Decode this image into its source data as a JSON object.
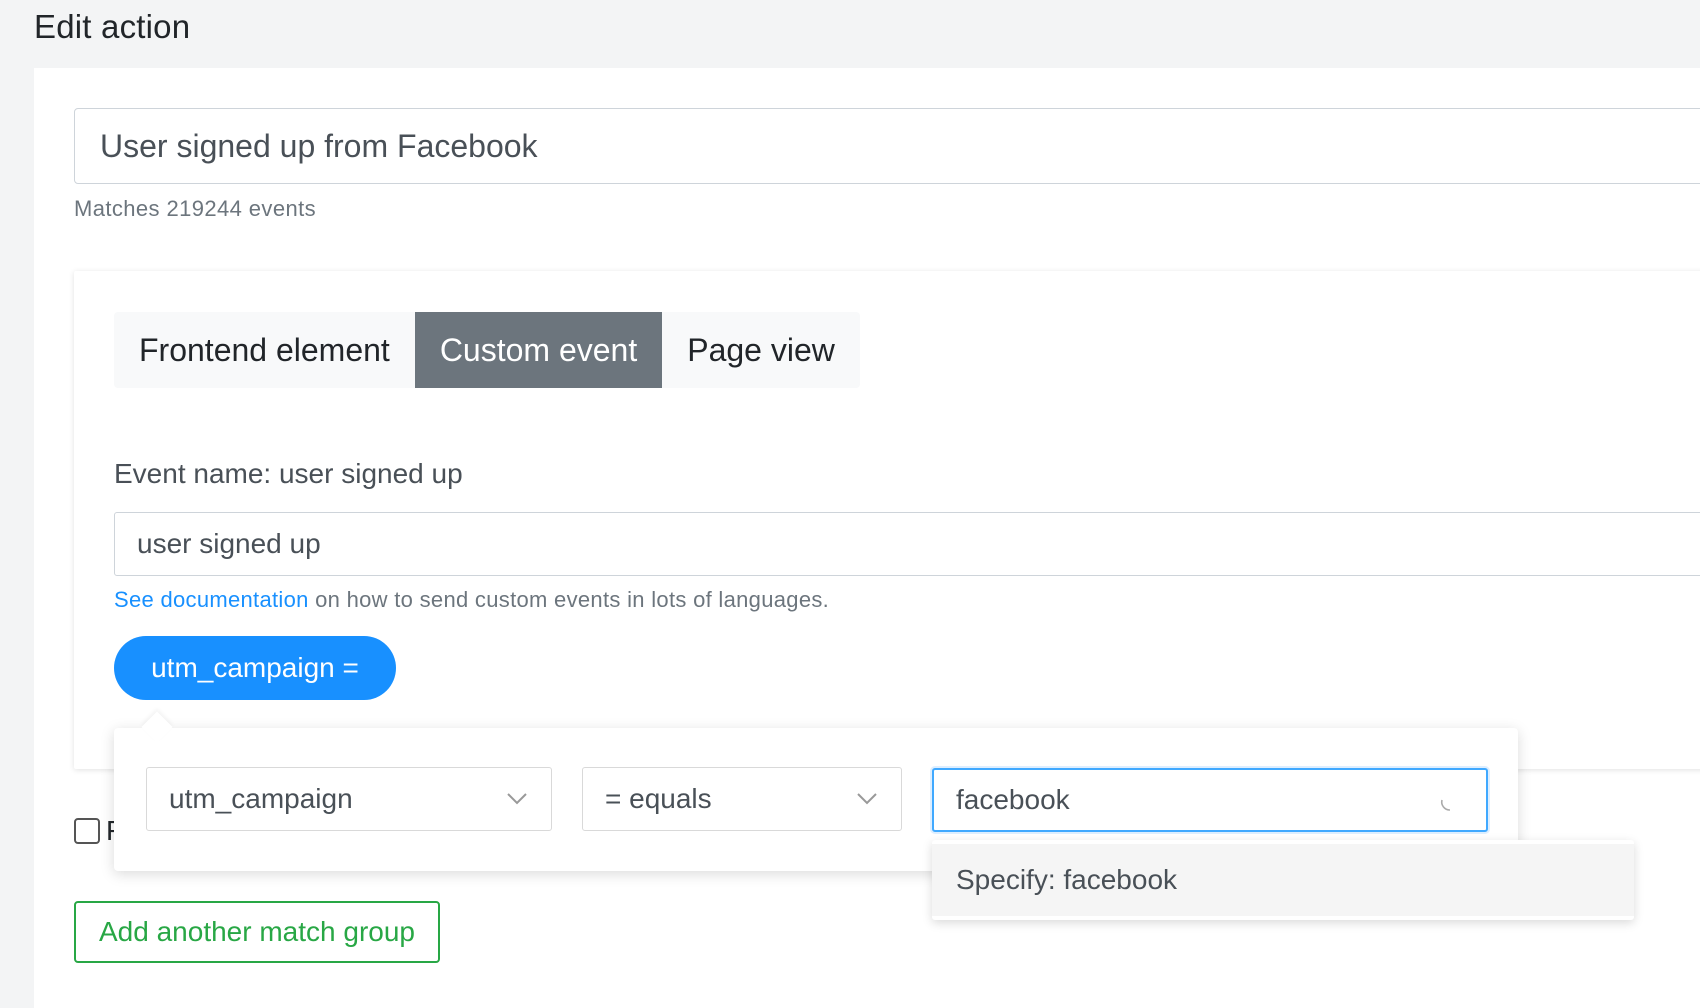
{
  "page": {
    "title": "Edit action"
  },
  "action": {
    "name": "User signed up from Facebook",
    "matches_text": "Matches 219244 events"
  },
  "match_group": {
    "tabs": [
      {
        "label": "Frontend element",
        "active": false
      },
      {
        "label": "Custom event",
        "active": true
      },
      {
        "label": "Page view",
        "active": false
      }
    ],
    "event_name_label": "Event name: user signed up",
    "event_name_value": "user signed up",
    "doc_link_text": "See documentation",
    "doc_hint_rest": " on how to send custom events in lots of languages.",
    "filter_pill_label": "utm_campaign ="
  },
  "filter_popover": {
    "key_value": "utm_campaign",
    "operator_value": "= equals",
    "value_input": "facebook",
    "dropdown_option": "Specify: facebook"
  },
  "checkbox": {
    "label_fragment": "F"
  },
  "buttons": {
    "add_match_group": "Add another match group"
  },
  "colors": {
    "primary": "#1890ff",
    "active_tab": "#6c757d",
    "success": "#28a745",
    "focus_border": "#40a9ff"
  },
  "icons": {
    "select_chevron": "chevron-down-icon",
    "loading": "spinner-icon"
  }
}
